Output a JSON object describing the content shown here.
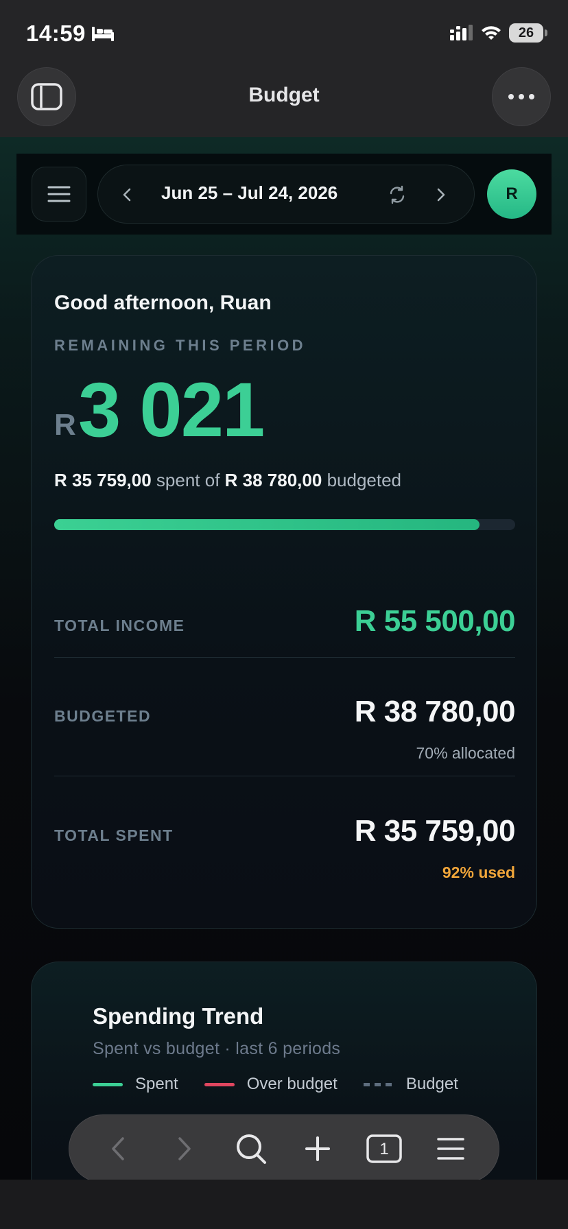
{
  "status_bar": {
    "time": "14:59",
    "battery": "26"
  },
  "browser": {
    "title": "Budget"
  },
  "nav": {
    "date_range": "Jun 25 – Jul 24, 2026",
    "avatar_initial": "R"
  },
  "summary": {
    "greeting": "Good afternoon, Ruan",
    "remaining_label": "REMAINING THIS PERIOD",
    "remaining_currency": "R",
    "remaining_amount": "3 021",
    "spent_amount": "R 35 759,00",
    "spent_text": "spent of",
    "budgeted_amount": "R 38 780,00",
    "budgeted_text": "budgeted",
    "progress_fraction": 0.922,
    "total_income_label": "TOTAL INCOME",
    "total_income_value": "R 55 500,00",
    "budgeted_label": "BUDGETED",
    "budgeted_value": "R 38 780,00",
    "budgeted_sub": "70% allocated",
    "total_spent_label": "TOTAL SPENT",
    "total_spent_value": "R 35 759,00",
    "total_spent_sub": "92% used"
  },
  "trend": {
    "title": "Spending Trend",
    "subtitle": "Spent vs budget · last 6 periods",
    "legend": [
      {
        "label": "Spent",
        "color": "#3ccf95"
      },
      {
        "label": "Over budget",
        "color": "#e0465f"
      },
      {
        "label": "Budget",
        "color": "#5e6d7e"
      }
    ]
  },
  "toolbar": {
    "tab_count": "1"
  },
  "colors": {
    "accent": "#3ccf95",
    "warning": "#f0a53a",
    "over": "#e0465f"
  }
}
